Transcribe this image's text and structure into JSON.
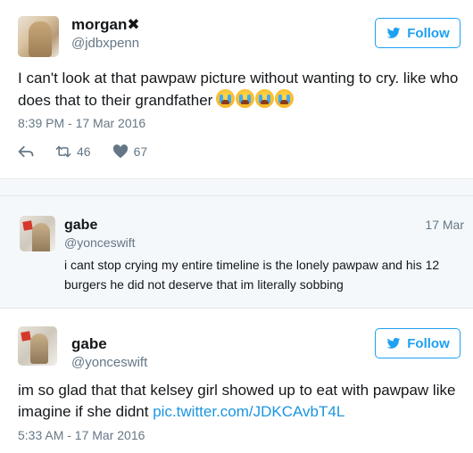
{
  "tweets": [
    {
      "name": "morgan✖",
      "handle": "@jdbxpenn",
      "follow_label": "Follow",
      "text": "I can't look at that pawpaw picture without wanting to cry. like who does that to their grandfather",
      "emoji_count": 4,
      "timestamp": "8:39 PM - 17 Mar 2016",
      "retweets": "46",
      "likes": "67"
    },
    {
      "name": "gabe",
      "handle": "@yonceswift",
      "date": "17 Mar",
      "text": "i cant stop crying my entire timeline is the lonely pawpaw and his 12 burgers he did not deserve that im literally sobbing"
    },
    {
      "name": "gabe",
      "handle": "@yonceswift",
      "follow_label": "Follow",
      "text": "im so glad that that kelsey girl showed up to eat with pawpaw like imagine if she didnt",
      "link": "pic.twitter.com/JDKCAvbT4L",
      "timestamp": "5:33 AM - 17 Mar 2016"
    }
  ],
  "colors": {
    "accent": "#1da1f2",
    "link": "#1b95e0",
    "muted": "#657786",
    "reply_bg": "#f5f8fa"
  }
}
